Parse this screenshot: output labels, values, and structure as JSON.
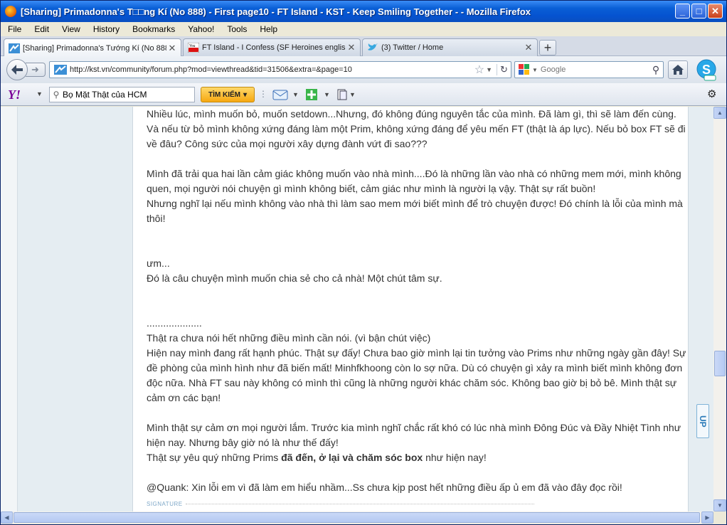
{
  "window": {
    "title": "[Sharing] Primadonna's T□□ng Kí (No 888) - First page10 - FT Island - KST - Keep Smiling Together - - Mozilla Firefox",
    "minimize": "_",
    "maximize": "□",
    "close": "✕"
  },
  "menu": [
    "File",
    "Edit",
    "View",
    "History",
    "Bookmarks",
    "Yahoo!",
    "Tools",
    "Help"
  ],
  "tabs": [
    {
      "label": "[Sharing] Primadonna's Tướng Kí (No 888...",
      "icon": "kst-site-icon",
      "active": true
    },
    {
      "label": "FT Island - I Confess (SF Heroines englis...",
      "icon": "youtube-icon",
      "active": false
    },
    {
      "label": "(3) Twitter / Home",
      "icon": "twitter-bird-icon",
      "active": false
    }
  ],
  "new_tab_label": "+",
  "nav": {
    "url": "http://kst.vn/community/forum.php?mod=viewthread&tid=31506&extra=&page=10",
    "search_placeholder": "Google"
  },
  "yahoo": {
    "logo": "Y!",
    "search_value": "Bọ Mặt Thật của HCM",
    "search_button": "TÌM KIẾM"
  },
  "post": {
    "para1": "Nhiều lúc, mình muốn bỏ, muốn setdown...Nhưng, đó không đúng nguyên tắc của mình. Đã làm gì, thì sẽ làm đến cùng. Và nếu từ bỏ mình không xứng đáng làm một Prim, không xứng đáng để yêu mến FT (thật là áp lực). Nếu bỏ box FT sẽ đi về đâu? Công sức của mọi người xây dựng đành vứt đi sao???",
    "para2": "Mình đã trải qua hai lần cảm giác không muốn vào nhà mình....Đó là những lần vào nhà có những mem mới, mình không quen, mọi người nói chuyện gì mình không biết, cảm giác như mình là người lạ vậy. Thật sự rất buồn!",
    "para3": "Nhưng nghĩ lại nếu mình không vào nhà thì làm sao mem mới biết mình để trò chuyện được! Đó chính là lỗi của mình mà thôi!",
    "para4": "ưm...",
    "para5": "Đó là câu chuyện mình muốn chia sẻ cho cả nhà! Một chút tâm sự.",
    "dots": "....................",
    "para6": "Thật ra chưa nói hết những điều mình cần nói. (vì bận chút việc)",
    "para7": "Hiện nay mình đang rất hạnh phúc. Thật sự đấy! Chưa bao giờ mình lại tin tưởng vào Prims như những ngày gần đây! Sự đề phòng của mình hình như đã biến mất! Minhfkhoong còn lo sợ nữa. Dù có chuyện gì xảy ra mình biết mình không đơn độc nữa. Nhà FT sau này không có mình thì cũng là những người khác chăm sóc. Không bao giờ bị bỏ bê. Mình thật sự cảm ơn các bạn!",
    "para8": "Mình thật sự cảm ơn mọi người lắm. Trước kia mình nghĩ chắc rất khó có lúc nhà mình Đông Đúc và Đầy Nhiệt Tình như hiện nay. Nhưng bây giờ nó là như thế đấy!",
    "para9_start": "Thật sự yêu quý những Prims ",
    "para9_bold": "đã đến, ở lại và chăm sóc box",
    "para9_end": " như hiện nay!",
    "para10": "@Quank: Xin lỗi em vì đã làm em hiểu nhầm...Ss chưa kịp post hết những điều ấp ủ em đã vào đây đọc rồi!",
    "signature_label": "SIGNATURE"
  },
  "up_button": "UP"
}
